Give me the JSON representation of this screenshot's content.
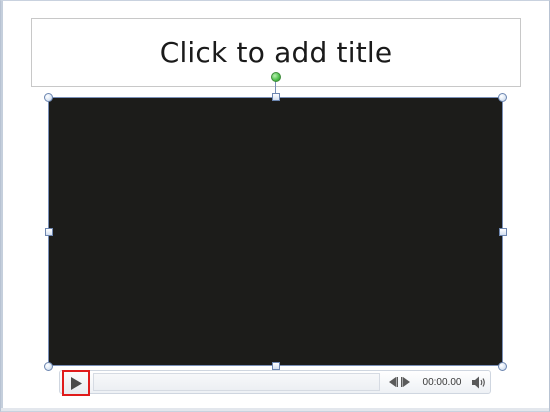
{
  "slide": {
    "title_placeholder": "Click to add title"
  },
  "media_controls": {
    "play_icon": "play-icon",
    "move_back_icon": "move-back-icon",
    "move_forward_icon": "move-forward-icon",
    "volume_icon": "volume-icon",
    "time": "00:00.00",
    "progress": 0
  },
  "colors": {
    "video_background": "#1c1c1a",
    "selection_border": "#7a90b8",
    "rotate_handle": "#4cbf4a",
    "highlight_box": "#e01b1b"
  }
}
